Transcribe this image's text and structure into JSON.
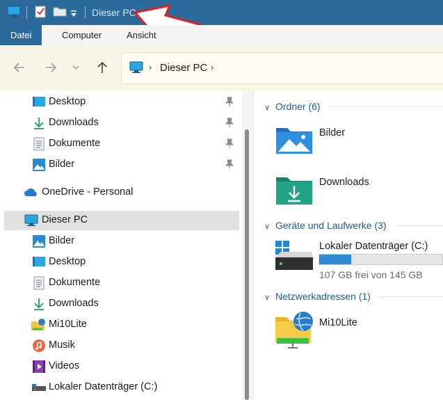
{
  "window": {
    "title": "Dieser PC"
  },
  "quick_access": {
    "icons": [
      "computer-icon",
      "properties-checklist-icon",
      "new-folder-icon",
      "customize-dropdown-icon"
    ]
  },
  "ribbon": {
    "tabs": [
      {
        "label": "Datei",
        "active": true
      },
      {
        "label": "Computer",
        "active": false
      },
      {
        "label": "Ansicht",
        "active": false
      }
    ],
    "accent": "#2b6a9a"
  },
  "address": {
    "path": [
      "Dieser PC"
    ]
  },
  "nav": {
    "quick_items": [
      {
        "label": "Desktop",
        "icon": "desktop-icon",
        "pinned": true
      },
      {
        "label": "Downloads",
        "icon": "downloads-icon",
        "pinned": true
      },
      {
        "label": "Dokumente",
        "icon": "documents-icon",
        "pinned": true
      },
      {
        "label": "Bilder",
        "icon": "pictures-icon",
        "pinned": true
      }
    ],
    "onedrive": {
      "label": "OneDrive - Personal",
      "icon": "onedrive-cloud-icon"
    },
    "this_pc": {
      "label": "Dieser PC",
      "icon": "computer-icon",
      "selected": true
    },
    "pc_items": [
      {
        "label": "Bilder",
        "icon": "pictures-icon"
      },
      {
        "label": "Desktop",
        "icon": "desktop-icon"
      },
      {
        "label": "Dokumente",
        "icon": "documents-icon"
      },
      {
        "label": "Downloads",
        "icon": "downloads-icon"
      },
      {
        "label": "Mi10Lite",
        "icon": "network-folder-icon"
      },
      {
        "label": "Musik",
        "icon": "music-icon"
      },
      {
        "label": "Videos",
        "icon": "videos-icon"
      },
      {
        "label": "Lokaler Datenträger (C:)",
        "icon": "drive-icon"
      }
    ]
  },
  "content": {
    "groups": {
      "folders": {
        "label": "Ordner (6)"
      },
      "devices": {
        "label": "Geräte und Laufwerke (3)"
      },
      "network": {
        "label": "Netzwerkadressen (1)"
      }
    },
    "folders": [
      {
        "label": "Bilder",
        "icon": "pictures-folder-icon"
      },
      {
        "label": "Downloads",
        "icon": "downloads-folder-icon"
      }
    ],
    "drive": {
      "label": "Lokaler Datenträger (C:)",
      "free_text": "107 GB frei von 145 GB",
      "used_fraction": 0.262,
      "bar_color": "#2a8ad4"
    },
    "network_item": {
      "label": "Mi10Lite"
    }
  }
}
